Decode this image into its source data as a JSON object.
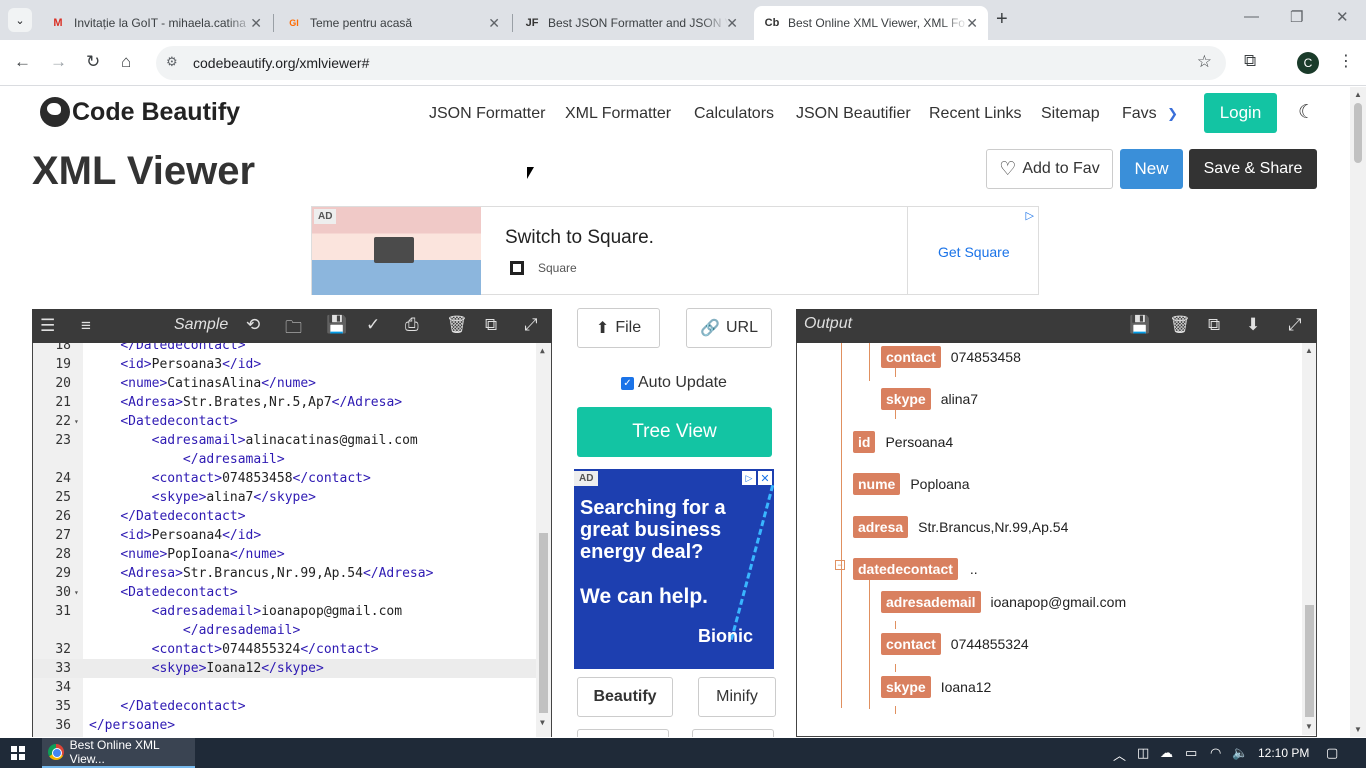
{
  "browser": {
    "tabs": [
      {
        "title": "Invitație la GoIT - mihaela.catina",
        "favicon": "gmail-icon",
        "active": false
      },
      {
        "title": "Teme pentru acasă",
        "favicon": "goit-icon",
        "active": false
      },
      {
        "title": "Best JSON Formatter and JSON V",
        "favicon": "JF",
        "active": false
      },
      {
        "title": "Best Online XML Viewer, XML Fo",
        "favicon": "Cb",
        "active": true
      }
    ],
    "url": "codebeautify.org/xmlviewer#",
    "profile_initial": "C"
  },
  "site": {
    "logo_text": "Code Beautify",
    "nav": [
      "JSON Formatter",
      "XML Formatter",
      "Calculators",
      "JSON Beautifier",
      "Recent Links",
      "Sitemap",
      "Favs"
    ],
    "login_label": "Login"
  },
  "page": {
    "title": "XML Viewer",
    "add_fav_label": "Add to Fav",
    "new_label": "New",
    "save_share_label": "Save & Share"
  },
  "ad_top": {
    "tag": "AD",
    "headline": "Switch to Square.",
    "brand": "Square",
    "cta": "Get Square"
  },
  "editor": {
    "sample_label": "Sample",
    "lines": [
      {
        "num": "18",
        "code": "    </Datedecontact>"
      },
      {
        "num": "19",
        "code": "    <id>Persoana3</id>"
      },
      {
        "num": "20",
        "code": "    <nume>CatinasAlina</nume>"
      },
      {
        "num": "21",
        "code": "    <Adresa>Str.Brates,Nr.5,Ap7</Adresa>"
      },
      {
        "num": "22",
        "code": "    <Datedecontact>",
        "fold": true
      },
      {
        "num": "23",
        "code": "        <adresamail>alinacatinas@gmail.com"
      },
      {
        "num": "",
        "code": "            </adresamail>"
      },
      {
        "num": "24",
        "code": "        <contact>074853458</contact>"
      },
      {
        "num": "25",
        "code": "        <skype>alina7</skype>"
      },
      {
        "num": "26",
        "code": "    </Datedecontact>"
      },
      {
        "num": "27",
        "code": "    <id>Persoana4</id>"
      },
      {
        "num": "28",
        "code": "    <nume>PopIoana</nume>"
      },
      {
        "num": "29",
        "code": "    <Adresa>Str.Brancus,Nr.99,Ap.54</Adresa>"
      },
      {
        "num": "30",
        "code": "    <Datedecontact>",
        "fold": true
      },
      {
        "num": "31",
        "code": "        <adresademail>ioanapop@gmail.com"
      },
      {
        "num": "",
        "code": "            </adresademail>"
      },
      {
        "num": "32",
        "code": "        <contact>0744855324</contact>"
      },
      {
        "num": "33",
        "code": "        <skype>Ioana12</skype>",
        "highlight": true
      },
      {
        "num": "34",
        "code": ""
      },
      {
        "num": "35",
        "code": "    </Datedecontact>"
      },
      {
        "num": "36",
        "code": "</persoane>"
      }
    ]
  },
  "middle": {
    "file_label": "File",
    "url_label": "URL",
    "auto_update_label": "Auto Update",
    "auto_update_checked": true,
    "tree_view_label": "Tree View",
    "beautify_label": "Beautify",
    "minify_label": "Minify"
  },
  "ad_side": {
    "tag": "AD",
    "line1": "Searching for a great business energy deal?",
    "line2": "We can help.",
    "brand": "Bionic"
  },
  "output": {
    "label": "Output",
    "nodes": [
      {
        "key": "contact",
        "value": "074853458"
      },
      {
        "key": "skype",
        "value": "alina7"
      },
      {
        "key": "id",
        "value": "Persoana4"
      },
      {
        "key": "nume",
        "value": "Poploana"
      },
      {
        "key": "adresa",
        "value": "Str.Brancus,Nr.99,Ap.54"
      },
      {
        "key": "datedecontact",
        "value": ".."
      },
      {
        "key": "adresademail",
        "value": "ioanapop@gmail.com"
      },
      {
        "key": "contact",
        "value": "0744855324"
      },
      {
        "key": "skype",
        "value": "Ioana12"
      }
    ]
  },
  "taskbar": {
    "app_label": "Best Online XML View...",
    "time": "12:10 PM"
  }
}
